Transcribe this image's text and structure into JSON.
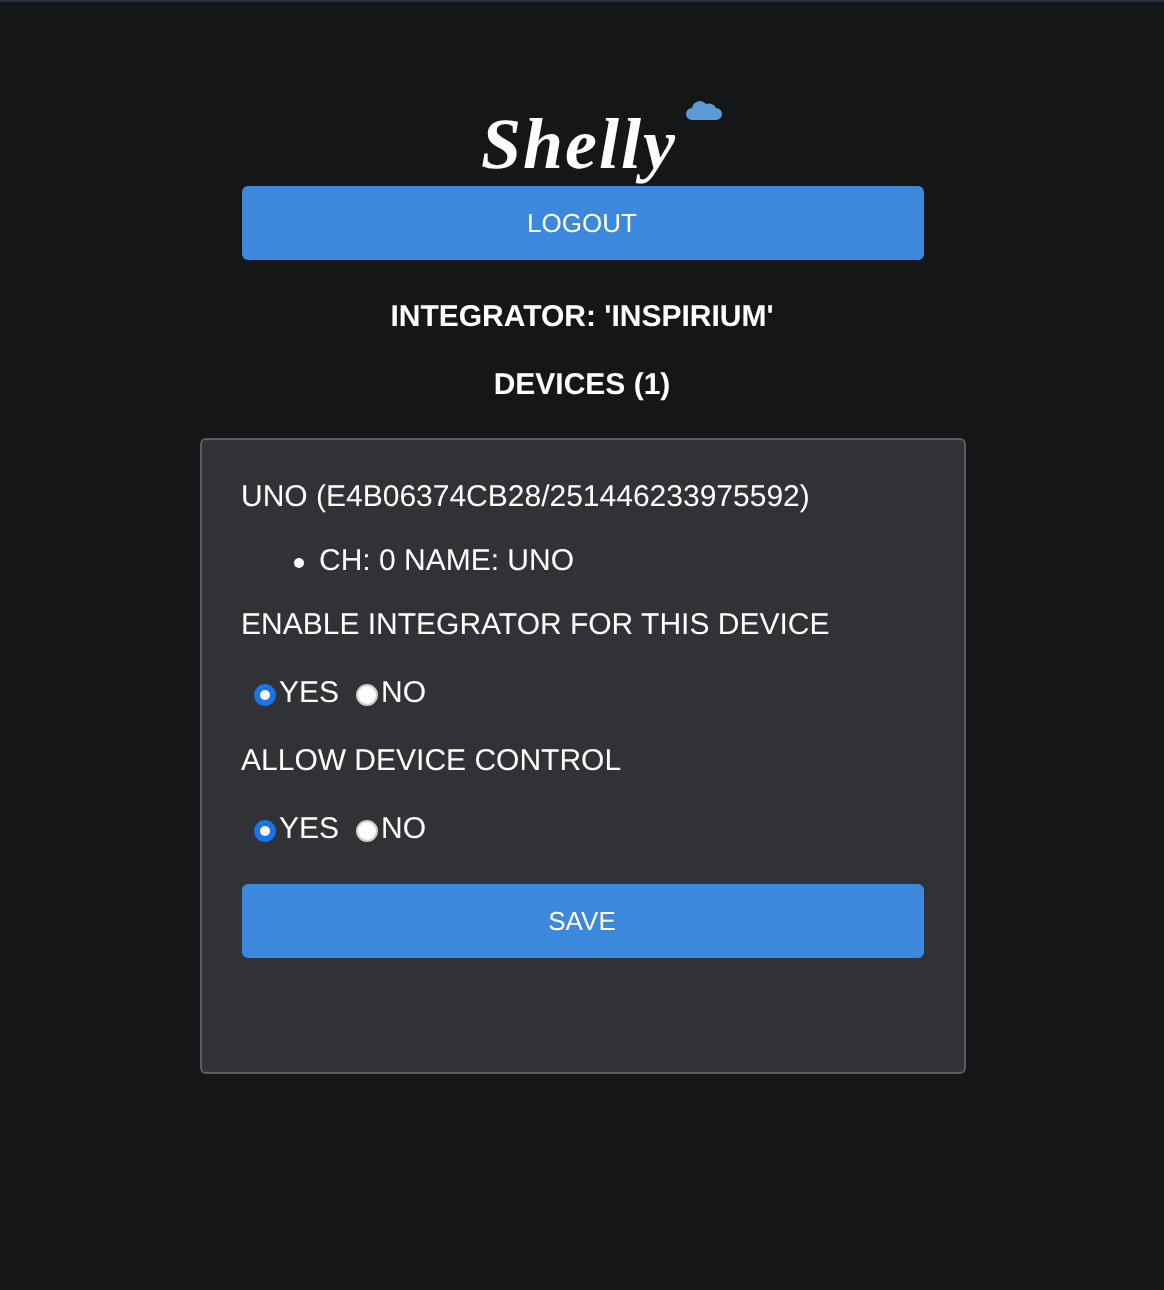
{
  "logo": {
    "text": "Shelly"
  },
  "logout_button": "LOGOUT",
  "integrator": "INTEGRATOR: 'INSPIRIUM'",
  "devices_heading": "DEVICES (1)",
  "device": {
    "title": "UNO (E4B06374CB28/251446233975592)",
    "channels": [
      "CH: 0 NAME: UNO"
    ],
    "settings": [
      {
        "label": "ENABLE INTEGRATOR FOR THIS DEVICE",
        "options": [
          {
            "label": "YES",
            "selected": true
          },
          {
            "label": "NO",
            "selected": false
          }
        ]
      },
      {
        "label": "ALLOW DEVICE CONTROL",
        "options": [
          {
            "label": "YES",
            "selected": true
          },
          {
            "label": "NO",
            "selected": false
          }
        ]
      }
    ],
    "save_button": "SAVE"
  }
}
